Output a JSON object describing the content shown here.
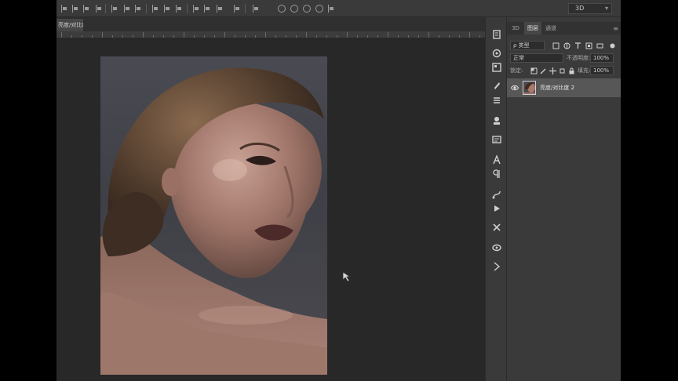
{
  "app": {
    "options_bar": {
      "mode_dropdown": "3D"
    },
    "document_tab": {
      "label": "亮度/对比度 1"
    },
    "panel": {
      "tabs": [
        {
          "label": "3D",
          "active": false
        },
        {
          "label": "图层",
          "active": true
        },
        {
          "label": "通道",
          "active": false
        }
      ],
      "filter_kind": "ρ 类型",
      "blend_mode": "正常",
      "opacity_label": "不透明度:",
      "opacity_value": "100%",
      "lock_label": "锁定:",
      "fill_label": "填充:",
      "fill_value": "100%",
      "layers": [
        {
          "name": "亮度/对比度 2",
          "visible": true,
          "selected": true
        }
      ]
    },
    "colors": {
      "workspace": "#262626",
      "panel": "#3a3a3a",
      "selected_layer": "#575757"
    }
  }
}
